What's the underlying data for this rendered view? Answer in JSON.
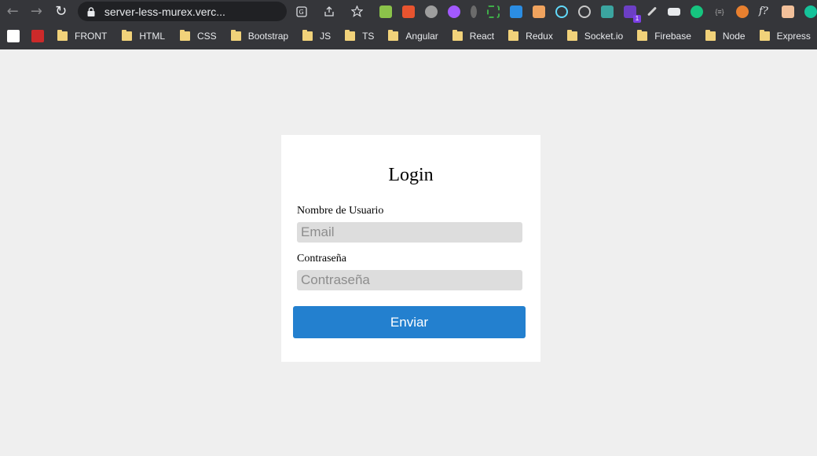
{
  "browser": {
    "url": "server-less-murex.verc...",
    "extensions_badge": "1",
    "nav_icons": [
      "back-arrow-icon",
      "forward-arrow-icon",
      "reload-icon"
    ],
    "omnibox_icons": [
      "lock-icon",
      "translate-icon",
      "share-icon",
      "star-bookmark-icon"
    ]
  },
  "bookmarks": {
    "items": [
      "FRONT",
      "HTML",
      "CSS",
      "Bootstrap",
      "JS",
      "TS",
      "Angular",
      "React",
      "Redux",
      "Socket.io",
      "Firebase",
      "Node",
      "Express"
    ],
    "folder_color": "#f1d27a"
  },
  "login": {
    "title": "Login",
    "username_label": "Nombre de Usuario",
    "username_placeholder": "Email",
    "password_label": "Contraseña",
    "password_placeholder": "Contraseña",
    "submit_label": "Enviar"
  },
  "colors": {
    "page_background": "#efefef",
    "card_background": "#ffffff",
    "input_background": "#dddddd",
    "button_background": "#2380cf",
    "chrome_background": "#35363a"
  }
}
